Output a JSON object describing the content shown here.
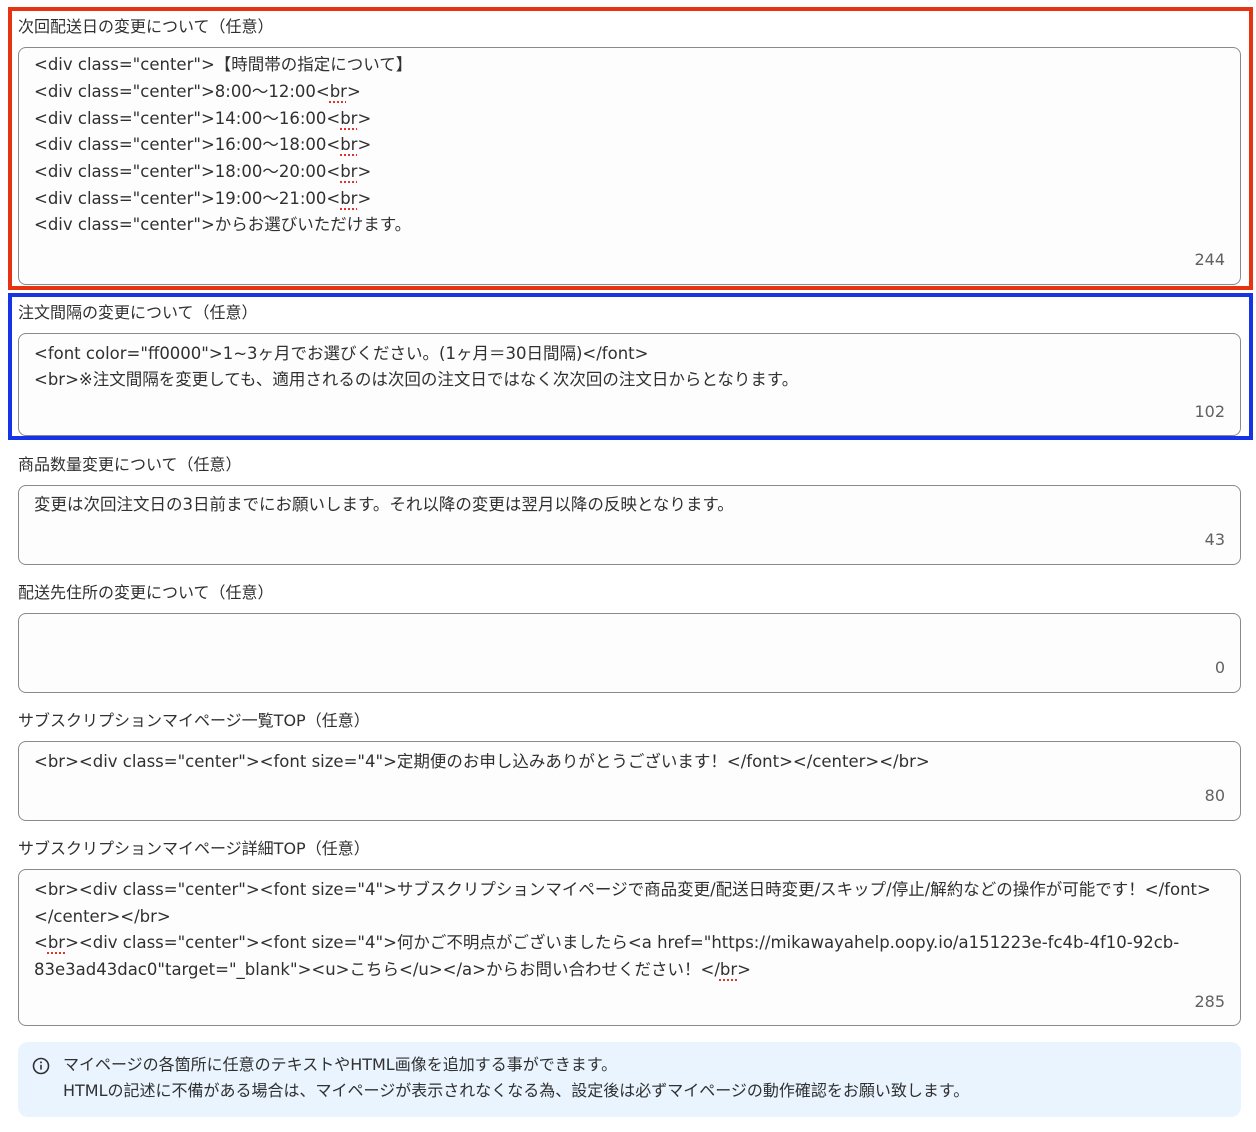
{
  "fields": [
    {
      "label": "次回配送日の変更について（任意）",
      "lines": [
        "<div class=\"center\">【時間帯の指定について】",
        "<div class=\"center\">8:00〜12:00<br>",
        "<div class=\"center\">14:00〜16:00<br>",
        "<div class=\"center\">16:00〜18:00<br>",
        "<div class=\"center\">18:00〜20:00<br>",
        "<div class=\"center\">19:00〜21:00<br>",
        "<div class=\"center\">からお選びいただけます。"
      ],
      "count": "244"
    },
    {
      "label": "注文間隔の変更について（任意）",
      "lines": [
        "<font color=\"ff0000\">1~3ヶ月でお選びください。(1ヶ月＝30日間隔)</font>",
        "<br>※注文間隔を変更しても、適用されるのは次回の注文日ではなく次次回の注文日からとなります。"
      ],
      "count": "102"
    },
    {
      "label": "商品数量変更について（任意）",
      "lines": [
        "変更は次回注文日の3日前までにお願いします。それ以降の変更は翌月以降の反映となります。"
      ],
      "count": "43"
    },
    {
      "label": "配送先住所の変更について（任意）",
      "lines": [],
      "count": "0"
    },
    {
      "label": "サブスクリプションマイページ一覧TOP（任意）",
      "lines": [
        "<br><div class=\"center\"><font size=\"4\">定期便のお申し込みありがとうございます！</font></center></br>"
      ],
      "count": "80"
    },
    {
      "label": "サブスクリプションマイページ詳細TOP（任意）",
      "lines": [
        "<br><div class=\"center\"><font size=\"4\">サブスクリプションマイページで商品変更/配送日時変更/スキップ/停止/解約などの操作が可能です！</font>",
        "</center></br>",
        "<br><div class=\"center\"><font size=\"4\">何かご不明点がございましたら<a href=\"https://mikawayahelp.oopy.io/a151223e-fc4b-4f10-92cb-",
        "83e3ad43dac0\"target=\"_blank\"><u>こちら</u></a>からお問い合わせください！</br>"
      ],
      "count": "285"
    }
  ],
  "banner": {
    "icon": "info-icon",
    "line1": "マイページの各箇所に任意のテキストやHTML画像を追加する事ができます。",
    "line2": "HTMLの記述に不備がある場合は、マイページが表示されなくなる為、設定後は必ずマイページの動作確認をお願い致します。"
  },
  "colors": {
    "highlight_red": "#e63312",
    "highlight_blue": "#1733e6",
    "banner_bg": "#eaf4ff"
  }
}
